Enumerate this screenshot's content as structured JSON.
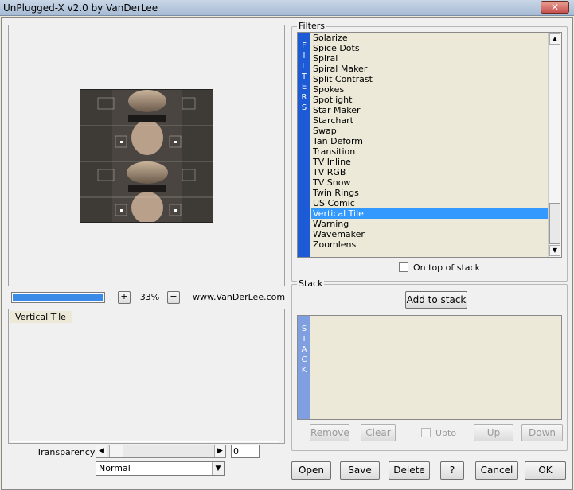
{
  "window": {
    "title": "UnPlugged-X v2.0 by VanDerLee",
    "close_glyph": "✕"
  },
  "preview": {
    "progress_percent": 100
  },
  "zoom": {
    "minus_label": "−",
    "plus_label": "+",
    "value": "33%"
  },
  "site": "www.VanDerLee.com",
  "selected_filter_label": "Vertical Tile",
  "transparency": {
    "label": "Transparency",
    "value": "0",
    "blend_mode": "Normal"
  },
  "filters": {
    "group_title": "Filters",
    "vertical_label": [
      "F",
      "I",
      "L",
      "T",
      "E",
      "R",
      "S"
    ],
    "items": [
      "Solarize",
      "Spice Dots",
      "Spiral",
      "Spiral Maker",
      "Split Contrast",
      "Spokes",
      "Spotlight",
      "Star Maker",
      "Starchart",
      "Swap",
      "Tan Deform",
      "Transition",
      "TV Inline",
      "TV RGB",
      "TV Snow",
      "Twin Rings",
      "US Comic",
      "Vertical Tile",
      "Warning",
      "Wavemaker",
      "Zoomlens"
    ],
    "selected_index": 17,
    "on_top_label": "On top of stack"
  },
  "stack": {
    "group_title": "Stack",
    "add_label": "Add to stack",
    "vertical_label": [
      "S",
      "T",
      "A",
      "C",
      "K"
    ],
    "remove_label": "Remove",
    "clear_label": "Clear",
    "upto_label": "Upto",
    "up_label": "Up",
    "down_label": "Down"
  },
  "footer": {
    "open_label": "Open",
    "save_label": "Save",
    "delete_label": "Delete",
    "help_label": "?",
    "cancel_label": "Cancel",
    "ok_label": "OK"
  }
}
